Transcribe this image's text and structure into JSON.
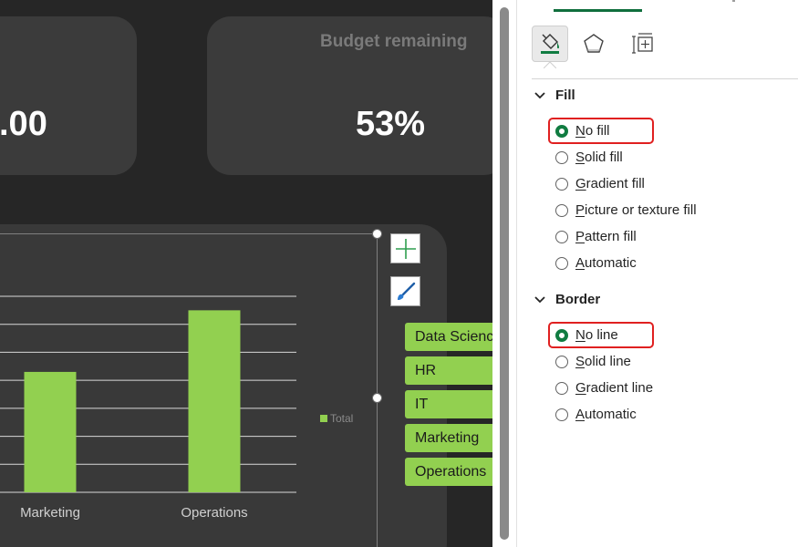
{
  "dashboard": {
    "card_budget": {
      "value": ".00"
    },
    "card_remaining": {
      "title": "Budget remaining",
      "value": "53%"
    },
    "chart_legend": "Total",
    "filter_items": [
      "Data Science",
      "HR",
      "IT",
      "Marketing",
      "Operations"
    ]
  },
  "chart_data": {
    "type": "bar",
    "categories": [
      "Marketing",
      "Operations"
    ],
    "series": [
      {
        "name": "Total",
        "values": [
          4.3,
          6.5
        ]
      }
    ],
    "ylim": [
      0,
      7
    ],
    "grid": true,
    "legend": "right",
    "colors": {
      "bar": "#92d050",
      "grid": "#d9d9d9"
    }
  },
  "pane": {
    "fill_heading": "Fill",
    "border_heading": "Border",
    "fill_options": [
      {
        "key": "N",
        "rest": "o fill",
        "checked": true,
        "highlighted": true
      },
      {
        "key": "S",
        "rest": "olid fill"
      },
      {
        "key": "G",
        "rest": "radient fill"
      },
      {
        "key": "P",
        "rest": "icture or texture fill"
      },
      {
        "key": "P",
        "rest": "attern fill",
        "prefix": "",
        "underline_index": 1
      },
      {
        "key": "A",
        "rest": "utomatic"
      }
    ],
    "border_options": [
      {
        "key": "N",
        "rest": "o line",
        "checked": true,
        "highlighted": true
      },
      {
        "key": "S",
        "rest": "olid line"
      },
      {
        "key": "G",
        "rest": "radient line"
      },
      {
        "key": "A",
        "rest": "utomatic"
      }
    ],
    "icons": [
      "fill-line-icon",
      "effects-icon",
      "size-properties-icon"
    ],
    "accent_color": "#107c41",
    "highlight_color": "#e02020"
  }
}
